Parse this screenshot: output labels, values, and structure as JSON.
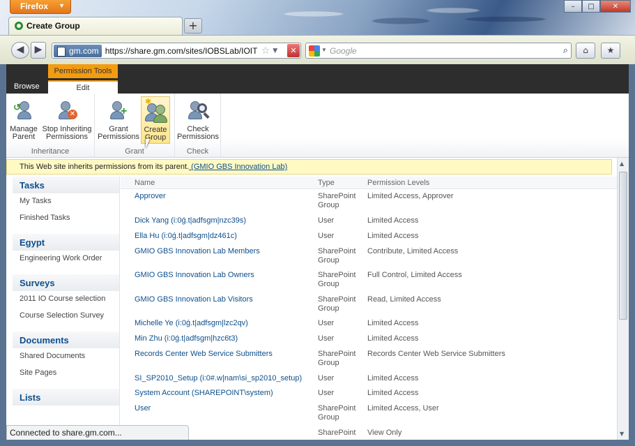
{
  "browser": {
    "menu_button": "Firefox",
    "tab_title": "Create Group",
    "new_tab": "+",
    "site_badge": "gm.com",
    "url": "https://share.gm.com/sites/IOBSLab/IOIT",
    "search_placeholder": "Google",
    "status_text": "Connected to share.gm.com..."
  },
  "ribbon": {
    "context_label": "Permission Tools",
    "tabs": [
      "Browse",
      "Edit"
    ],
    "groups": [
      {
        "label": "Inheritance",
        "buttons": [
          "Manage Parent",
          "Stop Inheriting Permissions"
        ]
      },
      {
        "label": "Grant",
        "buttons": [
          "Grant Permissions",
          "Create Group"
        ]
      },
      {
        "label": "Check",
        "buttons": [
          "Check Permissions"
        ]
      }
    ],
    "btn_text": {
      "manage": [
        "Manage",
        "Parent"
      ],
      "stop": [
        "Stop Inheriting",
        "Permissions"
      ],
      "grant": [
        "Grant",
        "Permissions"
      ],
      "create": [
        "Create",
        "Group"
      ],
      "check": [
        "Check",
        "Permissions"
      ]
    }
  },
  "notice": {
    "text": "This Web site inherits permissions from its parent.",
    "link": " (GMIO GBS Innovation Lab)"
  },
  "leftnav": {
    "sections": [
      {
        "title": "Tasks",
        "items": [
          "My Tasks",
          "Finished Tasks"
        ]
      },
      {
        "title": "Egypt",
        "items": [
          "Engineering Work Order"
        ]
      },
      {
        "title": "Surveys",
        "items": [
          "2011 IO Course selection",
          "Course Selection Survey"
        ]
      },
      {
        "title": "Documents",
        "items": [
          "Shared Documents",
          "Site Pages"
        ]
      },
      {
        "title": "Lists",
        "items": []
      }
    ]
  },
  "table": {
    "headers": [
      "Name",
      "Type",
      "Permission Levels"
    ],
    "rows": [
      {
        "name": "Approver",
        "type": "SharePoint Group",
        "levels": "Limited Access, Approver"
      },
      {
        "name": "Dick Yang (i:0ǵ.t|adfsgm|nzc39s)",
        "type": "User",
        "levels": "Limited Access"
      },
      {
        "name": "Ella Hu (i:0ǵ.t|adfsgm|dz461c)",
        "type": "User",
        "levels": "Limited Access"
      },
      {
        "name": "GMIO GBS Innovation Lab Members",
        "type": "SharePoint Group",
        "levels": "Contribute, Limited Access"
      },
      {
        "name": "GMIO GBS Innovation Lab Owners",
        "type": "SharePoint Group",
        "levels": "Full Control, Limited Access"
      },
      {
        "name": "GMIO GBS Innovation Lab Visitors",
        "type": "SharePoint Group",
        "levels": "Read, Limited Access"
      },
      {
        "name": "Michelle Ye (i:0ǵ.t|adfsgm|lzc2qv)",
        "type": "User",
        "levels": "Limited Access"
      },
      {
        "name": "Min Zhu (i:0ǵ.t|adfsgm|hzc6t3)",
        "type": "User",
        "levels": "Limited Access"
      },
      {
        "name": "Records Center Web Service Submitters",
        "type": "SharePoint Group",
        "levels": "Records Center Web Service Submitters"
      },
      {
        "name": "SI_SP2010_Setup (i:0#.w|nam\\si_sp2010_setup)",
        "type": "User",
        "levels": "Limited Access"
      },
      {
        "name": "System Account (SHAREPOINT\\system)",
        "type": "User",
        "levels": "Limited Access"
      },
      {
        "name": "User",
        "type": "SharePoint Group",
        "levels": "Limited Access, User"
      },
      {
        "name": "",
        "type": "SharePoint",
        "levels": "View Only"
      }
    ]
  }
}
